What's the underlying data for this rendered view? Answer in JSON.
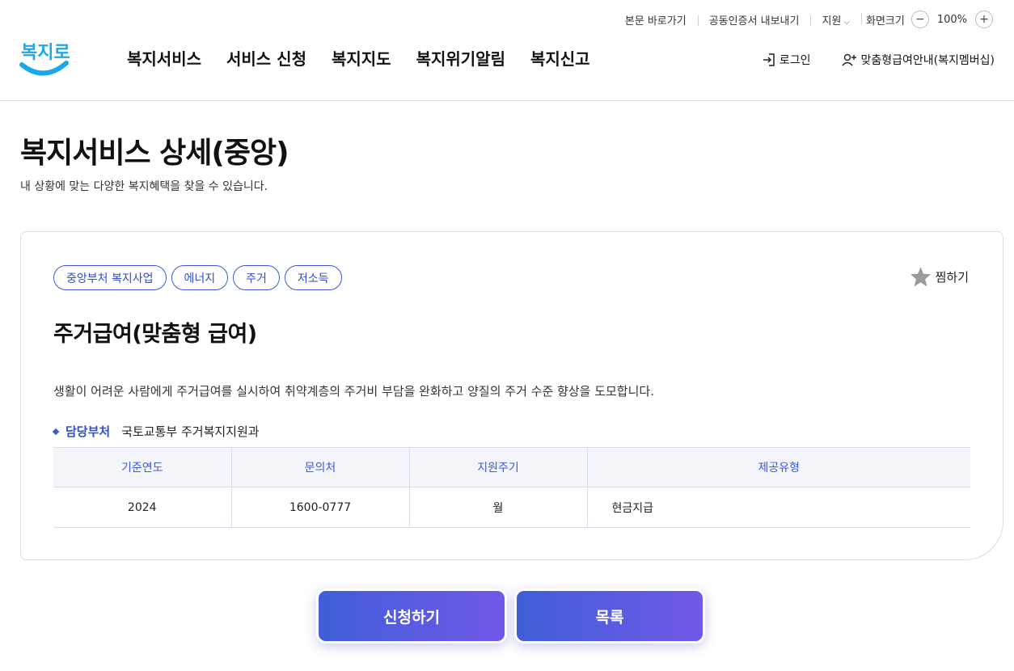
{
  "utility": {
    "skip_link": "본문 바로가기",
    "cert_export": "공동인증서 내보내기",
    "support": "지원",
    "screen_size_label": "화면크기",
    "zoom_value": "100%"
  },
  "logo": {
    "text": "복지로"
  },
  "nav": {
    "items": [
      {
        "label": "복지서비스"
      },
      {
        "label": "서비스 신청"
      },
      {
        "label": "복지지도"
      },
      {
        "label": "복지위기알림"
      },
      {
        "label": "복지신고"
      }
    ]
  },
  "header_right": {
    "login_label": "로그인",
    "member_label": "맞춤형급여안내(복지멤버십)"
  },
  "page": {
    "title": "복지서비스 상세(중앙)",
    "subtitle": "내 상황에 맞는 다양한 복지혜택을 찾을 수 있습니다."
  },
  "service": {
    "tags": [
      "중앙부처 복지사업",
      "에너지",
      "주거",
      "저소득"
    ],
    "favorite_label": "찜하기",
    "title": "주거급여(맞춤형 급여)",
    "description": "생활이 어려운 사람에게 주거급여를 실시하여 취약계층의 주거비 부담을 완화하고 양질의 주거 수준 향상을 도모합니다.",
    "department_label": "담당부처",
    "department_value": "국토교통부 주거복지지원과",
    "table": {
      "headers": [
        "기준연도",
        "문의처",
        "지원주기",
        "제공유형"
      ],
      "row": [
        "2024",
        "1600-0777",
        "월",
        "현금지급"
      ]
    }
  },
  "buttons": {
    "apply_label": "신청하기",
    "list_label": "목록"
  },
  "colors": {
    "accent": "#3b5bd6",
    "logo_blue": "#1aa9e8",
    "button_gradient_start": "#3f5ed8",
    "button_gradient_end": "#7158e8"
  }
}
